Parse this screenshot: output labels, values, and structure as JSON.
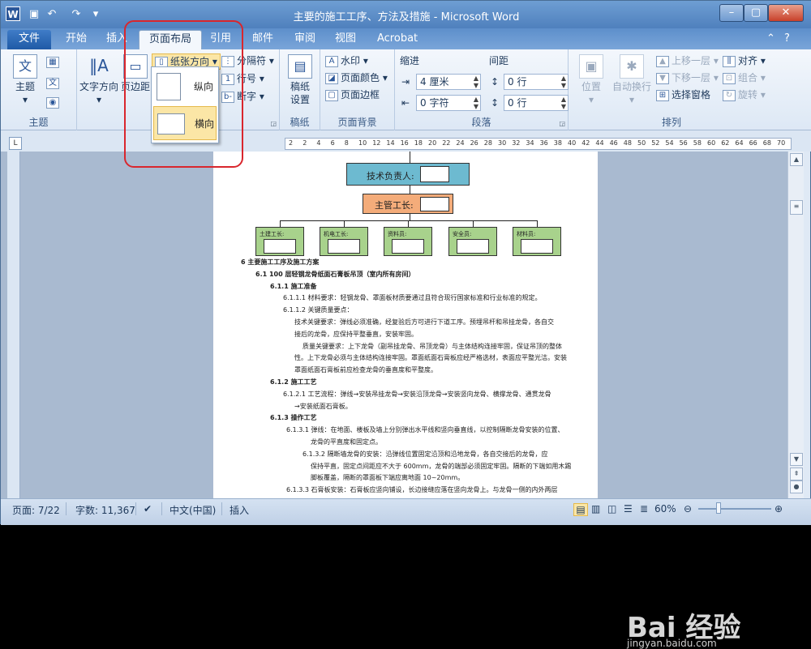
{
  "window": {
    "title": "主要的施工工序、方法及措施 - Microsoft Word",
    "app_icon": "W",
    "minimize": "–",
    "maximize": "▢",
    "close": "✕"
  },
  "quick_access": [
    "save-icon",
    "undo-icon",
    "redo-icon",
    "customize-icon"
  ],
  "tabs": [
    {
      "label": "文件"
    },
    {
      "label": "开始"
    },
    {
      "label": "插入"
    },
    {
      "label": "页面布局"
    },
    {
      "label": "引用"
    },
    {
      "label": "邮件"
    },
    {
      "label": "审阅"
    },
    {
      "label": "视图"
    },
    {
      "label": "Acrobat"
    }
  ],
  "active_tab": "页面布局",
  "ribbon": {
    "theme": {
      "themes_label": "主题",
      "group_label": "主题"
    },
    "page_setup": {
      "text_direction": "文字方向",
      "margins": "页边距",
      "orientation": "纸张方向",
      "breaks": "分隔符",
      "line_numbers": "行号",
      "hyphenation": "断字",
      "group_label": "页"
    },
    "draft": {
      "draft_settings_line1": "稿纸",
      "draft_settings_line2": "设置",
      "group_label": "稿纸"
    },
    "page_background": {
      "watermark": "水印",
      "page_color": "页面颜色",
      "page_borders": "页面边框",
      "group_label": "页面背景"
    },
    "paragraph": {
      "indent_label": "缩进",
      "spacing_label": "间距",
      "indent_left": "4 厘米",
      "indent_right": "0 字符",
      "spacing_before": "0 行",
      "spacing_after": "0 行",
      "group_label": "段落"
    },
    "arrange": {
      "position": "位置",
      "wrap_text": "自动换行",
      "bring_forward": "上移一层",
      "send_backward": "下移一层",
      "selection_pane": "选择窗格",
      "align": "对齐",
      "group": "组合",
      "rotate": "旋转",
      "group_label": "排列"
    }
  },
  "orientation_menu": {
    "portrait": "纵向",
    "landscape": "横向"
  },
  "ruler": {
    "marks": [
      "2",
      "2",
      "4",
      "6",
      "8",
      "10",
      "12",
      "14",
      "16",
      "18",
      "20",
      "22",
      "24",
      "26",
      "28",
      "30",
      "32",
      "34",
      "36",
      "38",
      "40",
      "42",
      "44",
      "46",
      "48",
      "50",
      "52",
      "54",
      "56",
      "58",
      "60",
      "62",
      "64",
      "66",
      "68",
      "70"
    ]
  },
  "document": {
    "org_chart": {
      "tech_lead": "技术负责人:",
      "foreman": "主管工长:",
      "staff": [
        "土建工长:",
        "机电工长:",
        "资料员:",
        "安全员:",
        "材料员:"
      ]
    },
    "lines": [
      {
        "t": "6    主要施工工序及施工方案",
        "b": true
      },
      {
        "t": "6.1   100 层轻钢龙骨纸面石膏板吊顶（室内所有房间）",
        "b": true
      },
      {
        "t": "6.1.1 施工准备",
        "b": true
      },
      {
        "t": "6.1.1.1    材料要求：轻钢龙骨、罩面板材质要通过且符合现行国家标准和行业标准的规定。",
        "b": false
      },
      {
        "t": "6.1.1.2    关键质量要点：",
        "b": false
      },
      {
        "t": "技术关键要求：弹线必须准确，经复验后方可进行下道工序。预埋吊杆和吊挂龙骨，各自交",
        "b": false
      },
      {
        "t": "接后的龙骨，应保持平整垂直，安装牢固。",
        "b": false
      },
      {
        "t": "质量关键要求：上下龙骨（副吊挂龙骨、吊顶龙骨）与主体结构连接牢固，保证吊顶的整体",
        "b": false
      },
      {
        "t": "性。上下龙骨必须与主体结构连接牢固。罩面纸面石膏板应经严格选材，表面应平整光洁。安装",
        "b": false
      },
      {
        "t": "罩面纸面石膏板前应检查龙骨的垂直度和平整度。",
        "b": false
      },
      {
        "t": "6.1.2 施工工艺",
        "b": true
      },
      {
        "t": "6.1.2.1    工艺流程：弹线→安装吊挂龙骨→安装沿顶龙骨→安装竖向龙骨、横撑龙骨、通贯龙骨",
        "b": false
      },
      {
        "t": "→安装纸面石膏板。",
        "b": false
      },
      {
        "t": "6.1.3 操作工艺",
        "b": true
      },
      {
        "t": "6.1.3.1    弹线：在地面、楼板及墙上分别弹出水平线和竖向垂直线，以控制隔断龙骨安装的位置、",
        "b": false
      },
      {
        "t": "龙骨的平直度和固定点。",
        "b": false
      },
      {
        "t": "6.1.3.2    隔断墙龙骨的安装：沿弹线位置固定沿顶和沿地龙骨，各自交接后的龙骨，应",
        "b": false
      },
      {
        "t": "保持平直，固定点间距应不大于 600mm，龙骨的端部必须固定牢固。隔断的下端如用木踢",
        "b": false
      },
      {
        "t": "脚板覆盖，隔断的罩面板下端应离地面 10~20mm。",
        "b": false
      },
      {
        "t": "6.1.3.3    石膏板安装：石膏板应竖向铺设，长边接缝应落在竖向龙骨上。与龙骨一侧的内外两层",
        "b": false
      }
    ]
  },
  "statusbar": {
    "page": "页面: 7/22",
    "words": "字数: 11,367",
    "language": "中文(中国)",
    "mode": "插入",
    "zoom": "60%"
  },
  "watermark": {
    "brand": "Bai 经验",
    "url": "jingyan.baidu.com"
  },
  "colors": {
    "tech_lead_box": "#6dbad0",
    "foreman_box": "#f4ac7a",
    "staff_box": "#a8d28c",
    "highlight": "#d9262d"
  }
}
